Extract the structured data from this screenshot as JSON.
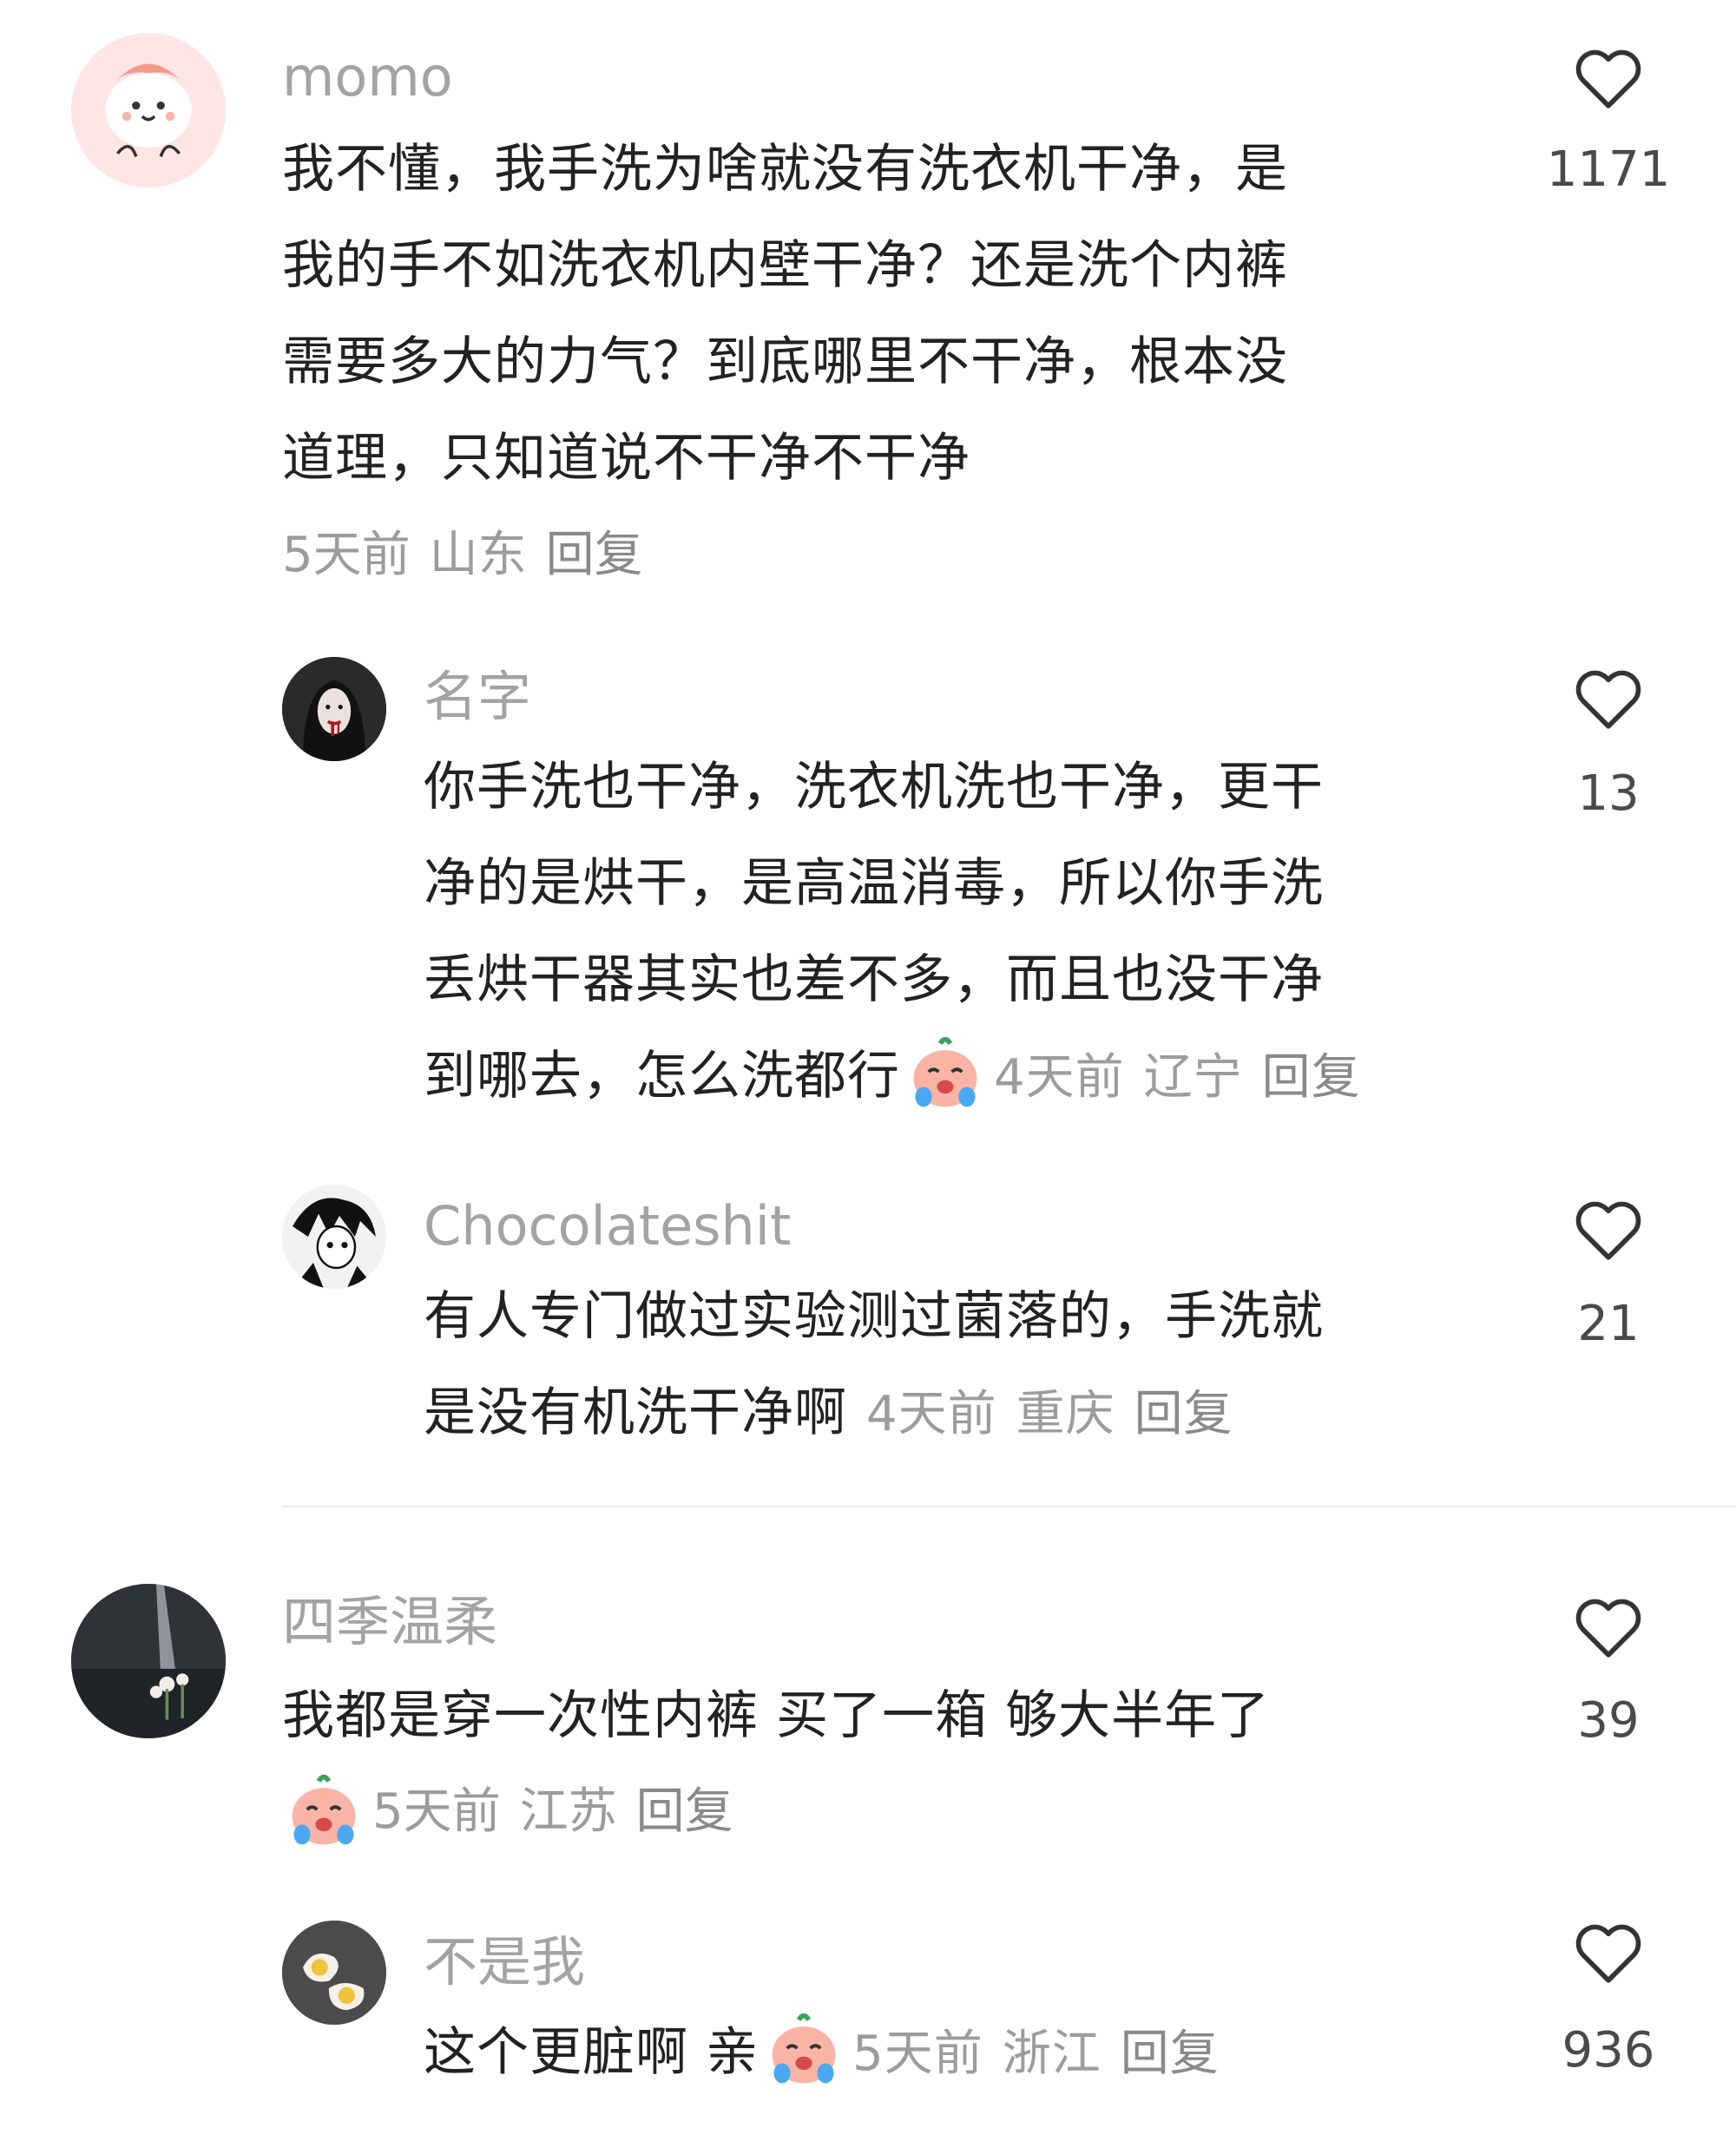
{
  "comments": [
    {
      "username": "momo",
      "text": "我不懂，我手洗为啥就没有洗衣机干净，是我的手不如洗衣机内壁干净？还是洗个内裤需要多大的力气？到底哪里不干净，根本没道理，只知道说不干净不干净",
      "line1": "我不懂，我手洗为啥就没有洗衣机干净，是",
      "line2": "我的手不如洗衣机内壁干净？还是洗个内裤",
      "line3": "需要多大的力气？到底哪里不干净，根本没",
      "line4": "道理，只知道说不干净不干净",
      "time": "5天前",
      "location": "山东",
      "reply": "回复",
      "likes": "1171",
      "avatar_icon": "pink-cartoon-avatar"
    },
    {
      "username": "名字",
      "line1": "你手洗也干净，洗衣机洗也干净，更干",
      "line2": "净的是烘干，是高温消毒，所以你手洗",
      "line3": "丢烘干器其实也差不多，而且也没干净",
      "line4": "到哪去，怎么洗都行",
      "time": "4天前",
      "location": "辽宁",
      "reply": "回复",
      "likes": "13",
      "avatar_icon": "dark-portrait-avatar",
      "emoji_icon": "crying-face-emoji"
    },
    {
      "username": "Chocolateshit",
      "line1": "有人专门做过实验测过菌落的，手洗就",
      "line2": "是没有机洗干净啊",
      "time": "4天前",
      "location": "重庆",
      "reply": "回复",
      "likes": "21",
      "avatar_icon": "manga-avatar"
    },
    {
      "username": "四季温柔",
      "line1": "我都是穿一次性内裤 买了一箱 够大半年了",
      "time": "5天前",
      "location": "江苏",
      "reply": "回复",
      "likes": "39",
      "avatar_icon": "night-scene-avatar",
      "emoji_icon": "crying-face-emoji"
    },
    {
      "username": "不是我",
      "line1": "这个更脏啊 亲",
      "time": "5天前",
      "location": "浙江",
      "reply": "回复",
      "likes": "936",
      "avatar_icon": "eggs-avatar",
      "emoji_icon": "crying-face-emoji"
    }
  ],
  "like_icon": "heart-outline-icon",
  "colors": {
    "username": "#a3a3a3",
    "text": "#222222",
    "meta": "#9c9c9c",
    "divider": "#ececec"
  }
}
